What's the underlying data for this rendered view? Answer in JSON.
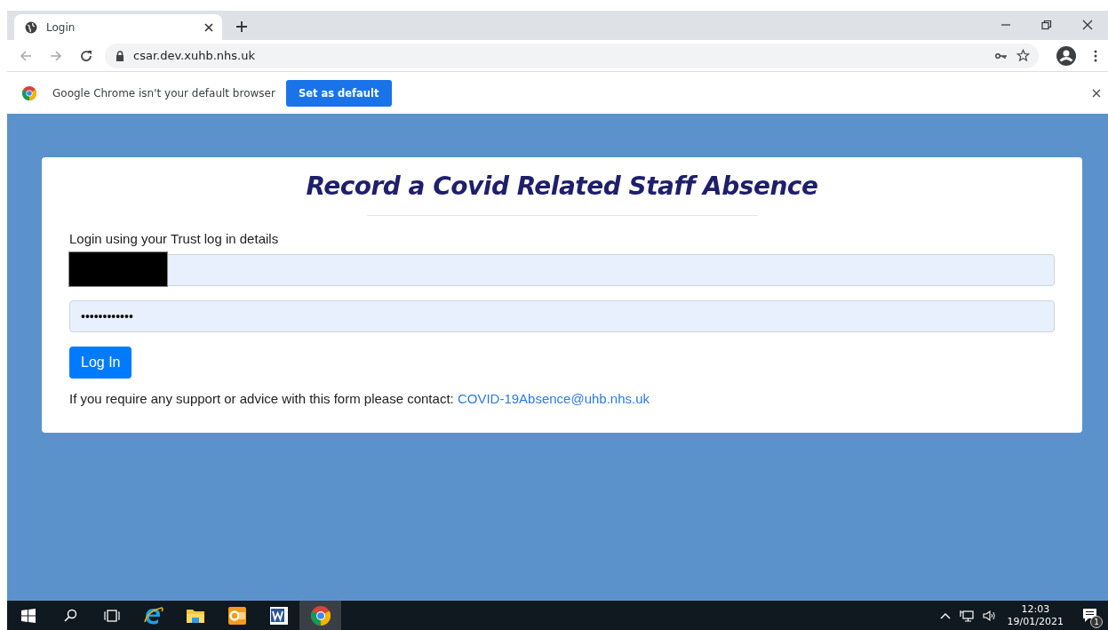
{
  "browser": {
    "tabs": [
      {
        "title": "Login",
        "selected": true
      }
    ],
    "url": "csar.dev.xuhb.nhs.uk"
  },
  "infobar": {
    "message": "Google Chrome isn't your default browser",
    "button": "Set as default"
  },
  "card": {
    "title": "Record a Covid Related Staff Absence",
    "instruction": "Login using your Trust log in details",
    "username": {
      "redacted": true
    },
    "password": {
      "value": "••••••••••••"
    },
    "button": "Log In",
    "support_text": "If you require any support or advice with this form please contact:",
    "support_link": "COVID-19Absence@uhb.nhs.uk"
  },
  "taskbar": {
    "apps": [
      {
        "kind": "ie",
        "selected": false
      },
      {
        "kind": "folder",
        "selected": false
      },
      {
        "kind": "outlook",
        "selected": false
      },
      {
        "kind": "word",
        "selected": false
      },
      {
        "kind": "chrome",
        "selected": true
      }
    ],
    "time": "12:03",
    "date": "19/01/2021",
    "notifications": "1"
  }
}
